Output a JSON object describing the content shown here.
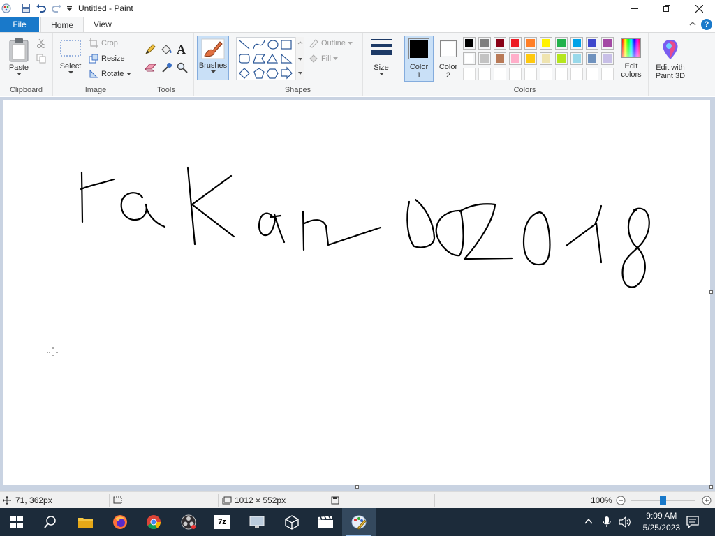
{
  "window": {
    "title": "Untitled - Paint"
  },
  "tabs": [
    {
      "label": "File"
    },
    {
      "label": "Home"
    },
    {
      "label": "View"
    }
  ],
  "ribbon": {
    "clipboard": {
      "label": "Clipboard",
      "paste": "Paste"
    },
    "image": {
      "label": "Image",
      "select": "Select",
      "crop": "Crop",
      "resize": "Resize",
      "rotate": "Rotate"
    },
    "tools": {
      "label": "Tools"
    },
    "brushes": {
      "label": "Brushes"
    },
    "shapes": {
      "label": "Shapes",
      "outline": "Outline",
      "fill": "Fill"
    },
    "size": {
      "label": "Size"
    },
    "colors": {
      "label": "Colors",
      "color1": "Color\n1",
      "color2": "Color\n2",
      "edit_colors": "Edit\ncolors",
      "palette_row1": [
        "#000000",
        "#7f7f7f",
        "#880015",
        "#ed1c24",
        "#ff7f27",
        "#fff200",
        "#22b14c",
        "#00a2e8",
        "#3f48cc",
        "#a349a4"
      ],
      "palette_row2": [
        "#ffffff",
        "#c3c3c3",
        "#b97a57",
        "#ffaec9",
        "#ffc90e",
        "#efe4b0",
        "#b5e61d",
        "#99d9ea",
        "#7092be",
        "#c8bfe7"
      ],
      "color1_value": "#000000",
      "color2_value": "#ffffff"
    },
    "paint3d": {
      "label": "Edit with\nPaint 3D"
    }
  },
  "status": {
    "cursor_pos": "71, 362px",
    "canvas_size": "1012 × 552px",
    "zoom": "100%"
  },
  "taskbar": {
    "time": "9:09 AM",
    "date": "5/25/2023"
  }
}
